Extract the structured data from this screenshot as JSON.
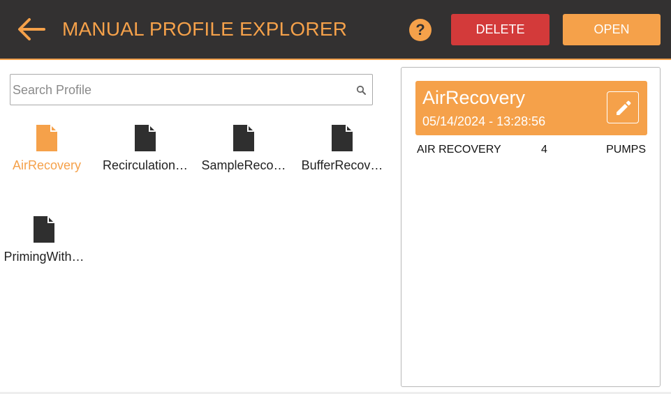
{
  "header": {
    "title": "MANUAL PROFILE EXPLORER",
    "help_label": "?",
    "delete_label": "DELETE",
    "open_label": "OPEN",
    "colors": {
      "background": "#333131",
      "accent": "#f5a14a",
      "danger": "#d33a3a"
    }
  },
  "search": {
    "placeholder": "Search Profile",
    "value": ""
  },
  "files": [
    {
      "label": "AirRecovery",
      "selected": true,
      "icon": "file-icon"
    },
    {
      "label": "Recirculation…",
      "selected": false,
      "icon": "file-icon"
    },
    {
      "label": "SampleReco…",
      "selected": false,
      "icon": "file-icon"
    },
    {
      "label": "BufferRecov…",
      "selected": false,
      "icon": "file-icon"
    },
    {
      "label": "PrimingWith…",
      "selected": false,
      "icon": "file-icon"
    }
  ],
  "details": {
    "name": "AirRecovery",
    "date": "05/14/2024 - 13:28:56",
    "edit_icon": "pencil-icon",
    "rows": [
      {
        "type": "AIR RECOVERY",
        "count": "4",
        "kind": "PUMPS"
      }
    ]
  }
}
